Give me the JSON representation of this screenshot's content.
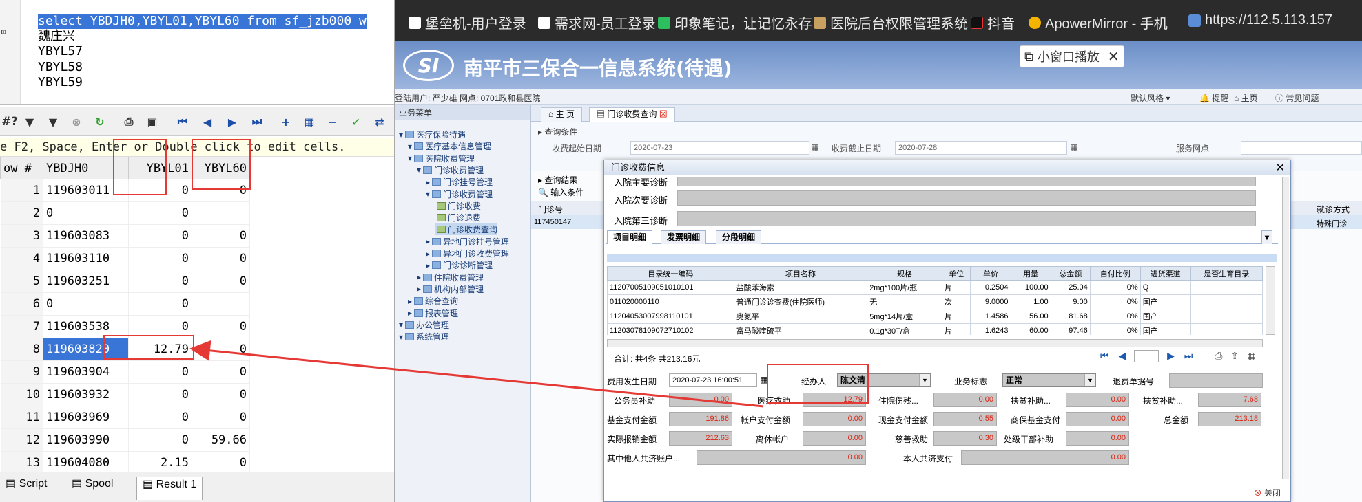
{
  "sql_editor": {
    "line1": "select YBDJH0,YBYL01,YBYL60 from sf_jzb000 w",
    "line2": "魏庄兴",
    "line3": "YBYL57",
    "line4": "YBYL58",
    "line5": "YBYL59",
    "gutter_icon": "⊞"
  },
  "grid_toolbar": {
    "partial": "#?",
    "icons": [
      "filter-icon",
      "filter-clear-icon",
      "cancel-icon",
      "refresh-icon",
      "print-icon",
      "save-icon",
      "first-icon",
      "prev-icon",
      "next-icon",
      "last-icon",
      "add-icon",
      "grid-icon",
      "remove-icon",
      "check-icon",
      "link-icon"
    ]
  },
  "hint_text": "e F2, Space, Enter or Double click to edit cells.",
  "grid": {
    "headers": [
      "ow #",
      "YBDJH0",
      "YBYL01",
      "YBYL60"
    ],
    "rows": [
      [
        "1",
        "119603011",
        "0",
        "0"
      ],
      [
        "2",
        "0",
        "0",
        ""
      ],
      [
        "3",
        "119603083",
        "0",
        "0"
      ],
      [
        "4",
        "119603110",
        "0",
        "0"
      ],
      [
        "5",
        "119603251",
        "0",
        "0"
      ],
      [
        "6",
        "0",
        "0",
        ""
      ],
      [
        "7",
        "119603538",
        "0",
        "0"
      ],
      [
        "8",
        "119603820",
        "12.79",
        "0"
      ],
      [
        "9",
        "119603904",
        "0",
        "0"
      ],
      [
        "10",
        "119603932",
        "0",
        "0"
      ],
      [
        "11",
        "119603969",
        "0",
        "0"
      ],
      [
        "12",
        "119603990",
        "0",
        "59.66"
      ],
      [
        "13",
        "119604080",
        "2.15",
        "0"
      ]
    ],
    "highlight_row": 8
  },
  "bottom_tabs": {
    "script": "Script",
    "spool": "Spool",
    "result": "Result 1"
  },
  "bookmarks": {
    "b1": "堡垒机-用户登录",
    "b2": "需求网-员工登录",
    "b3": "印象笔记，让记忆永存",
    "b4": "医院后台权限管理系统",
    "b5": "抖音",
    "b6": "ApowerMirror - 手机",
    "b7": "https://112.5.113.157"
  },
  "app": {
    "title": "南平市三保合一信息系统(待遇)",
    "pip_label": "小窗口播放",
    "user_info": "登陆用户: 严少雄  网点: 0701政和县医院",
    "theme": "默认风格",
    "remind": "提醒",
    "home": "主页",
    "faq": "常见问题"
  },
  "sidebar": {
    "header": "业务菜单",
    "items": [
      "医疗保险待遇",
      "医疗基本信息管理",
      "医院收费管理",
      "门诊收费管理",
      "门诊挂号管理",
      "门诊收费管理",
      "门诊收费",
      "门诊退费",
      "门诊收费查询",
      "异地门诊挂号管理",
      "异地门诊收费管理",
      "门诊诊断管理",
      "住院收费管理",
      "机构内部管理",
      "综合查询",
      "报表管理",
      "办公管理",
      "系统管理"
    ]
  },
  "page_tabs": {
    "home": "主 页",
    "query": "门诊收费查询"
  },
  "query": {
    "section": "查询条件",
    "start_label": "收费起始日期",
    "start_value": "2020-07-23",
    "end_label": "收费截止日期",
    "end_value": "2020-07-28",
    "site_label": "服务网点",
    "results_label": "查询结果",
    "input_label": "输入条件",
    "col_no": "门诊号",
    "col_mode": "就诊方式",
    "row_no": "117450147",
    "row_mode": "特殊门诊"
  },
  "modal": {
    "title": "门诊收费信息",
    "diag0": "入院主要诊断",
    "diag1": "入院次要诊断",
    "diag2": "入院第三诊断",
    "tabs": [
      "项目明细",
      "发票明细",
      "分段明细"
    ],
    "table_headers": [
      "目录统一编码",
      "项目名称",
      "规格",
      "单位",
      "单价",
      "用量",
      "总金额",
      "自付比例",
      "进货渠道",
      "是否生育目录"
    ],
    "table_rows": [
      [
        "11207005109051010101",
        "盐酸苯海索",
        "2mg*100片/瓶",
        "片",
        "0.2504",
        "100.00",
        "25.04",
        "0%",
        "Q",
        ""
      ],
      [
        "011020000110",
        "普通门诊诊查费(住院医师)",
        "无",
        "次",
        "9.0000",
        "1.00",
        "9.00",
        "0%",
        "国产",
        ""
      ],
      [
        "11204053007998110101",
        "奥氮平",
        "5mg*14片/盒",
        "片",
        "1.4586",
        "56.00",
        "81.68",
        "0%",
        "国产",
        ""
      ],
      [
        "11203078109072710102",
        "富马酸喹硫平",
        "0.1g*30T/盒",
        "片",
        "1.6243",
        "60.00",
        "97.46",
        "0%",
        "国产",
        ""
      ]
    ],
    "summary": "合计: 共4条 共213.16元",
    "fee_date_label": "费用发生日期",
    "fee_date": "2020-07-23 16:00:51",
    "handler_label": "经办人",
    "handler": "陈文清",
    "flag_label": "业务标志",
    "flag": "正常",
    "refund_label": "退费单据号",
    "f_civil_label": "公务员补助",
    "f_civil": "0.00",
    "f_medaid_label": "医疗救助",
    "f_medaid": "12.79",
    "f_residual_label": "住院伤残...",
    "f_residual": "0.00",
    "f_poor1_label": "扶贫补助...",
    "f_poor1": "0.00",
    "f_poor2_label": "扶贫补助...",
    "f_poor2": "7.68",
    "f_fund_label": "基金支付金额",
    "f_fund": "191.86",
    "f_account_label": "帐户支付金额",
    "f_account": "0.00",
    "f_cash_label": "现金支付金额",
    "f_cash": "0.55",
    "f_commercial_label": "商保基金支付",
    "f_commercial": "0.00",
    "f_total_label": "总金额",
    "f_total": "213.18",
    "f_actual_label": "实际报销金额",
    "f_actual": "212.63",
    "f_retired_label": "离休帐户",
    "f_retired": "0.00",
    "f_charity_label": "慈善救助",
    "f_charity": "0.30",
    "f_cadre_label": "处级干部补助",
    "f_cadre": "0.00",
    "f_other_label": "其中他人共济账户...",
    "f_other": "0.00",
    "f_self_label": "本人共济支付",
    "f_self": "0.00",
    "close_label": "关闭"
  },
  "colors": {
    "accent_red": "#e53935",
    "selection_blue": "#3875d7",
    "banner_blue": "#6c8fc8"
  }
}
